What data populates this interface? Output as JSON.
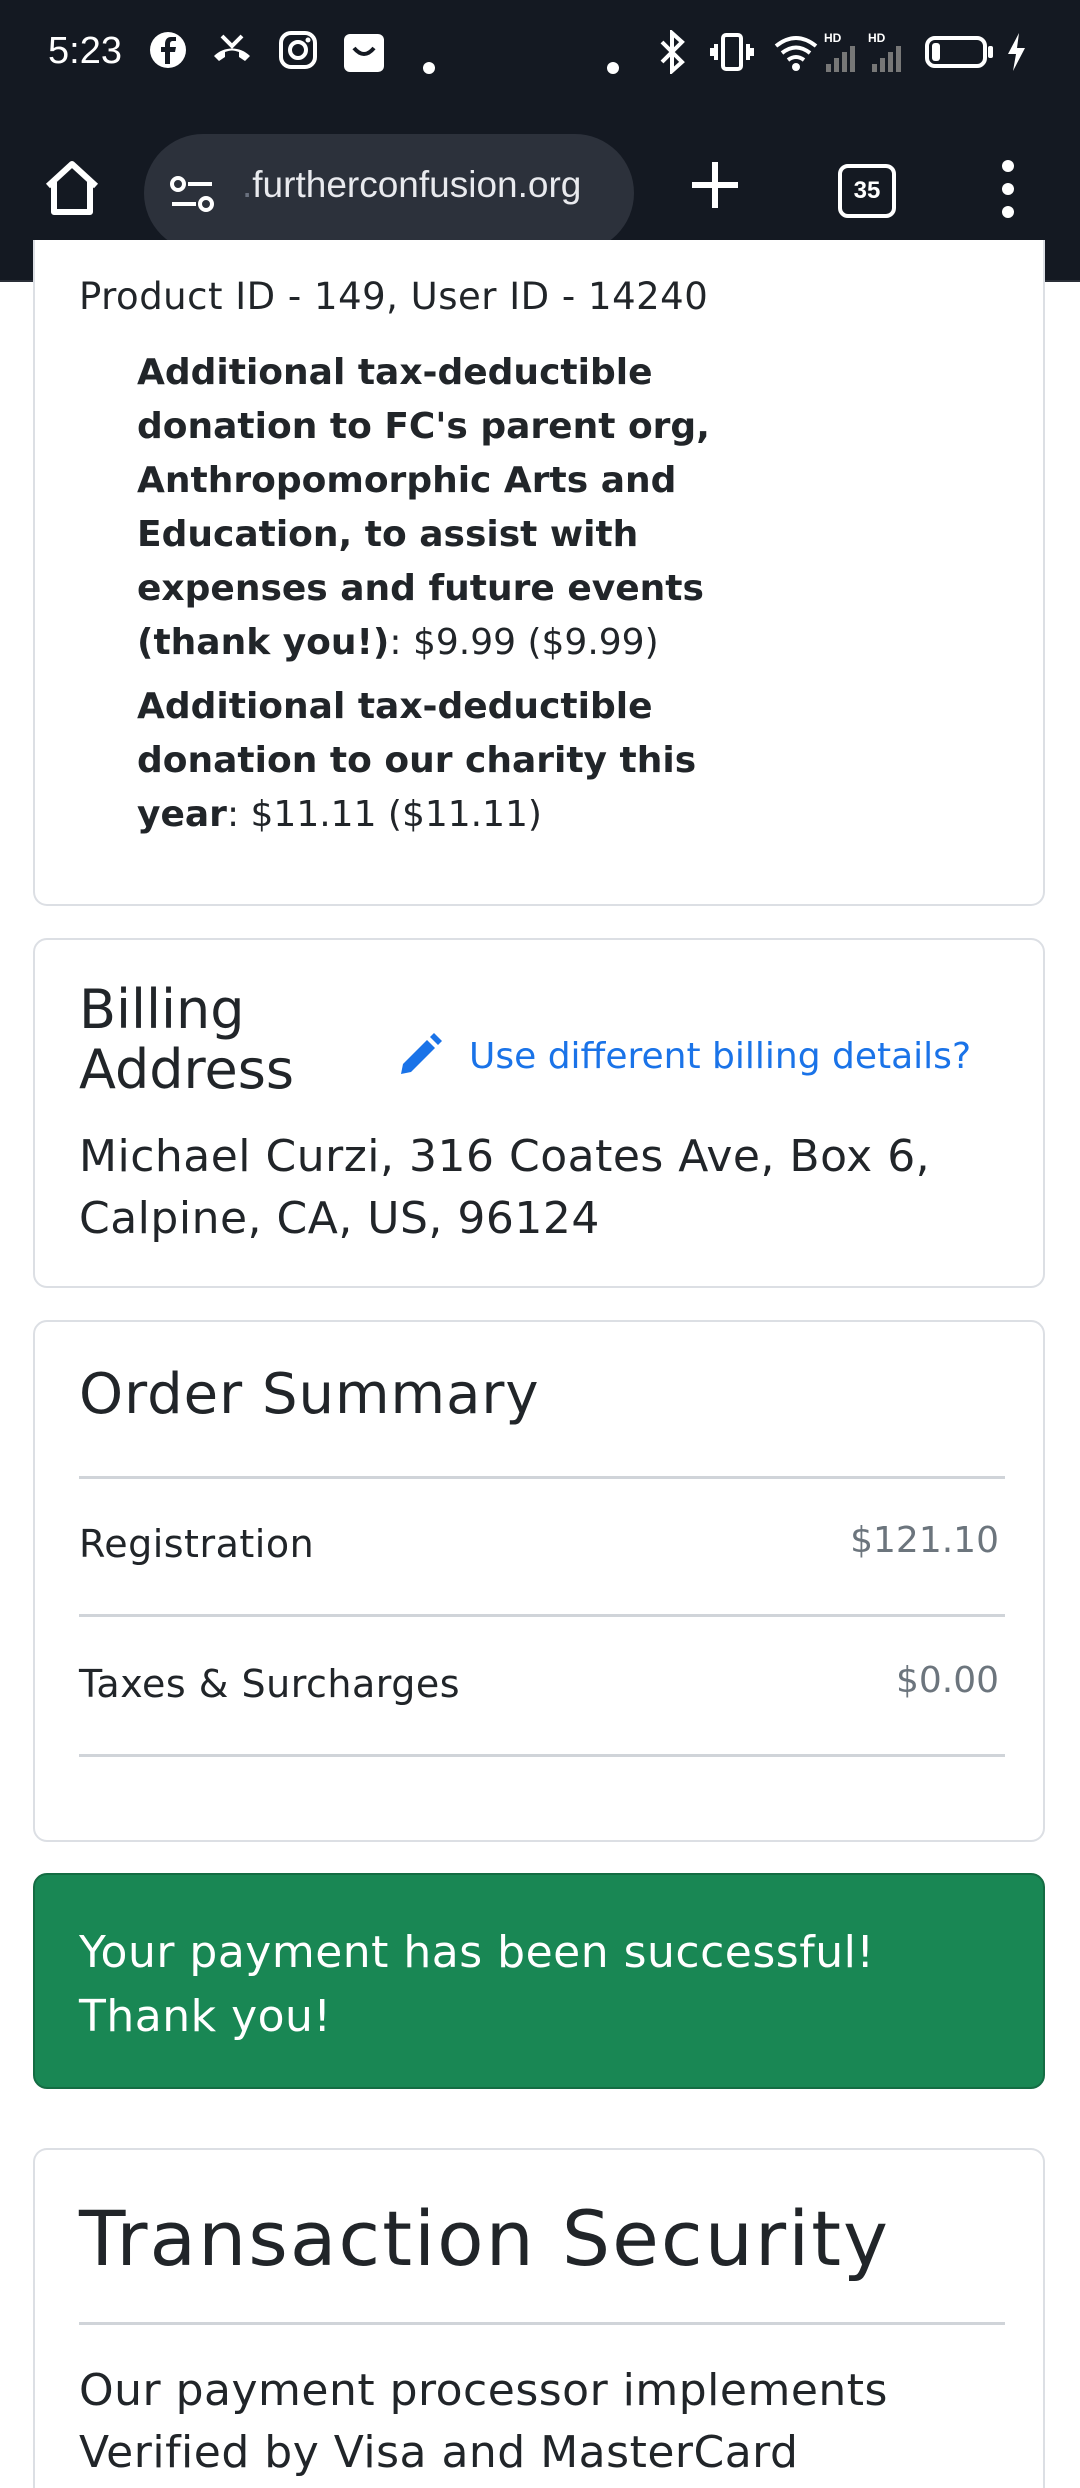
{
  "status_bar": {
    "time": "5:23",
    "icons": [
      "facebook-icon",
      "missed-call-icon",
      "instagram-icon",
      "shop-icon",
      "dot-icon",
      "dot-icon",
      "bluetooth-icon",
      "vibrate-icon",
      "wifi-icon",
      "signal-icon",
      "battery-icon",
      "charging-icon"
    ]
  },
  "browser": {
    "url_faded": ".",
    "url": "furtherconfusion.org",
    "tab_count": "35"
  },
  "product_card": {
    "product_line": "Product ID - 149, User ID - 14240",
    "addons": [
      {
        "label": "Additional tax-deductible donation to FC's parent org, Anthropomorphic Arts and Education, to assist with expenses and future events (thank you!)",
        "value": ": $9.99 ($9.99)"
      },
      {
        "label": "Additional tax-deductible donation to our charity this year",
        "value": ": $11.11 ($11.11)"
      }
    ]
  },
  "billing": {
    "title": "Billing Address",
    "change_link": "Use different billing details?",
    "address": "Michael Curzi, 316 Coates Ave, Box 6, Calpine, CA, US, 96124"
  },
  "order_summary": {
    "title": "Order Summary",
    "rows": [
      {
        "label": "Registration",
        "value": "$121.10"
      },
      {
        "label": "Taxes & Surcharges",
        "value": "$0.00"
      }
    ]
  },
  "alert": {
    "message": "Your payment has been successful! Thank you!",
    "color": "#198754"
  },
  "security": {
    "title": "Transaction Security",
    "text": "Our payment processor implements Verified by Visa and MasterCard"
  }
}
